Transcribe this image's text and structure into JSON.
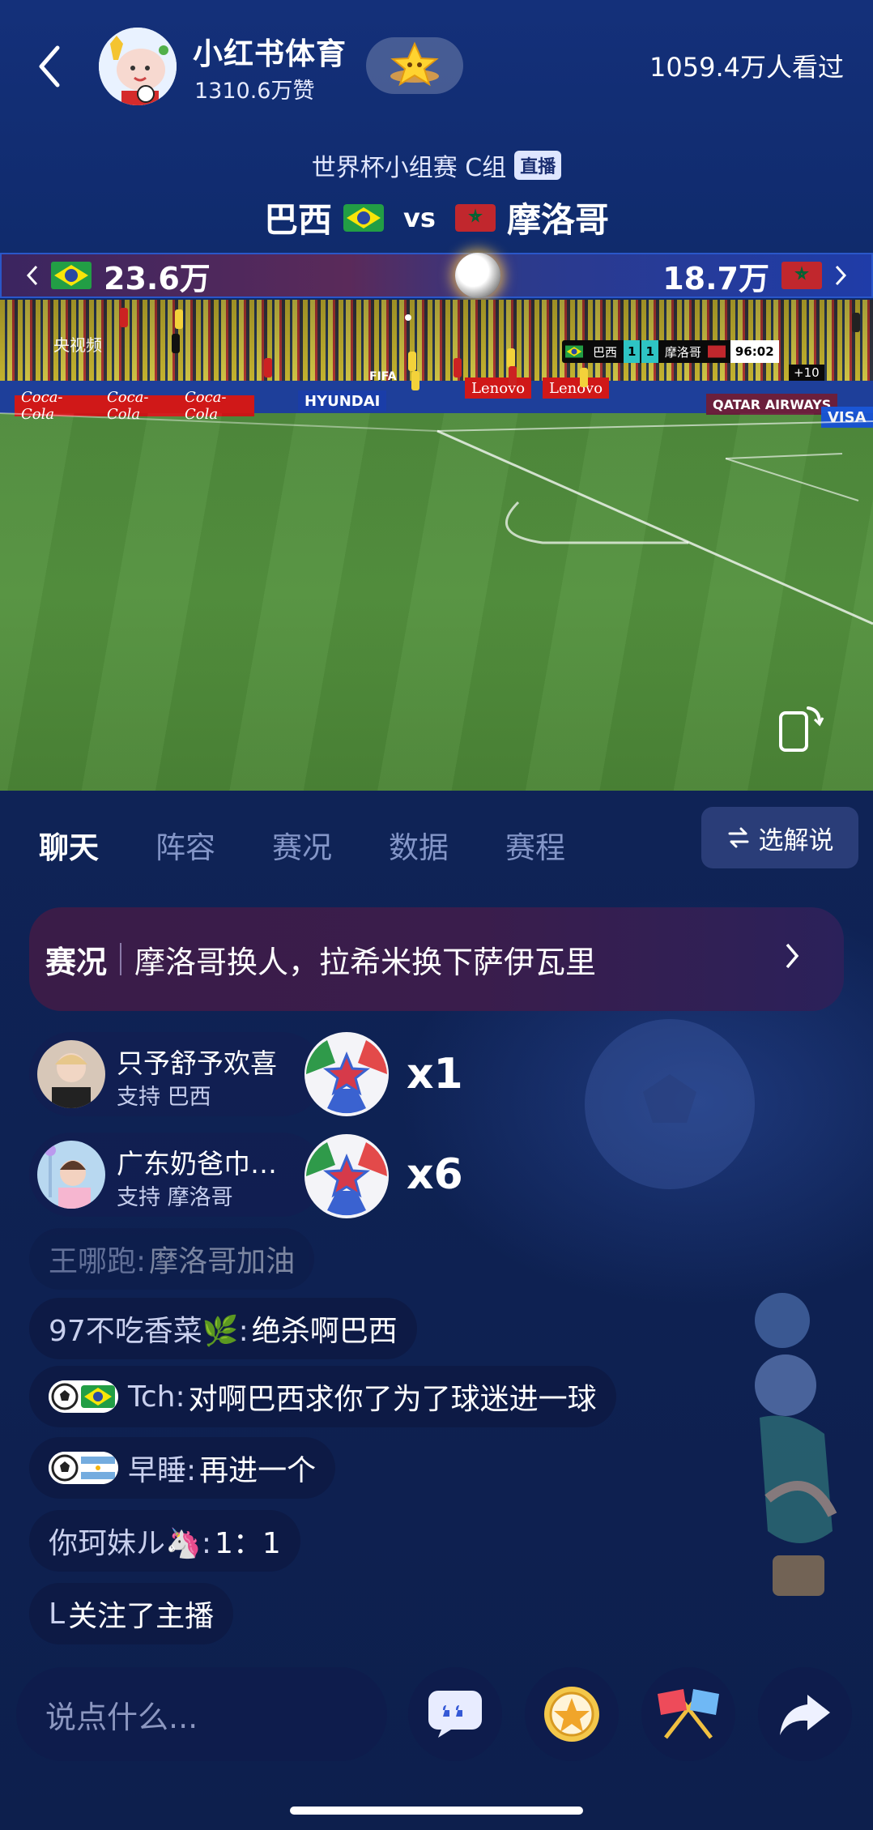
{
  "header": {
    "host_name": "小红书体育",
    "host_likes": "1310.6万赞",
    "viewers": "1059.4万人看过"
  },
  "match": {
    "stage": "世界杯小组赛 C组",
    "live_tag": "直播",
    "home_team": "巴西",
    "vs": "vs",
    "away_team": "摩洛哥",
    "home_support": "23.6万",
    "away_support": "18.7万"
  },
  "video": {
    "broadcaster": "央视频",
    "scorebug": {
      "home": "巴西",
      "home_score": "1",
      "away_score": "1",
      "away": "摩洛哥",
      "clock": "96:02",
      "extra_time": "+10"
    },
    "ads": [
      "Coca-Cola",
      "Coca-Cola",
      "Coca-Cola",
      "HYUNDAI",
      "Lenovo",
      "Lenovo",
      "QATAR AIRWAYS",
      "VISA",
      "FIFA"
    ]
  },
  "tabs": [
    "聊天",
    "阵容",
    "赛况",
    "数据",
    "赛程"
  ],
  "commentary_button": "选解说",
  "status_banner": {
    "label": "赛况",
    "text": "摩洛哥换人，拉希米换下萨伊瓦里"
  },
  "gifts": [
    {
      "name": "只予舒予欢喜",
      "support": "支持 巴西",
      "count": "x1"
    },
    {
      "name": "广东奶爸巾…",
      "support": "支持 摩洛哥",
      "count": "x6"
    }
  ],
  "chat": [
    {
      "user": "王哪跑:",
      "text": "摩洛哥加油",
      "dim": true
    },
    {
      "user": "97不吃香菜🌿:",
      "text": "绝杀啊巴西"
    },
    {
      "user": "Tch:",
      "text": "对啊巴西求你了为了球迷进一球",
      "flag": "brazil"
    },
    {
      "user": "早睡:",
      "text": "再进一个",
      "flag": "argentina"
    },
    {
      "user": "你珂妹ル🦄:",
      "text": "1：1"
    },
    {
      "user": "L",
      "text": "关注了主播"
    }
  ],
  "input": {
    "placeholder": "说点什么..."
  },
  "colors": {
    "background": "#0f2356",
    "tab_active": "#ffffff",
    "tab_inactive": "#8496c8",
    "banner": "#3a1c48"
  },
  "icons": [
    "back-arrow-icon",
    "star-badge-icon",
    "rotate-screen-icon",
    "swap-icon",
    "chevron-right-icon",
    "quote-bubble-icon",
    "soccer-ball-gift-icon",
    "crossed-flags-icon",
    "share-arrow-icon"
  ]
}
